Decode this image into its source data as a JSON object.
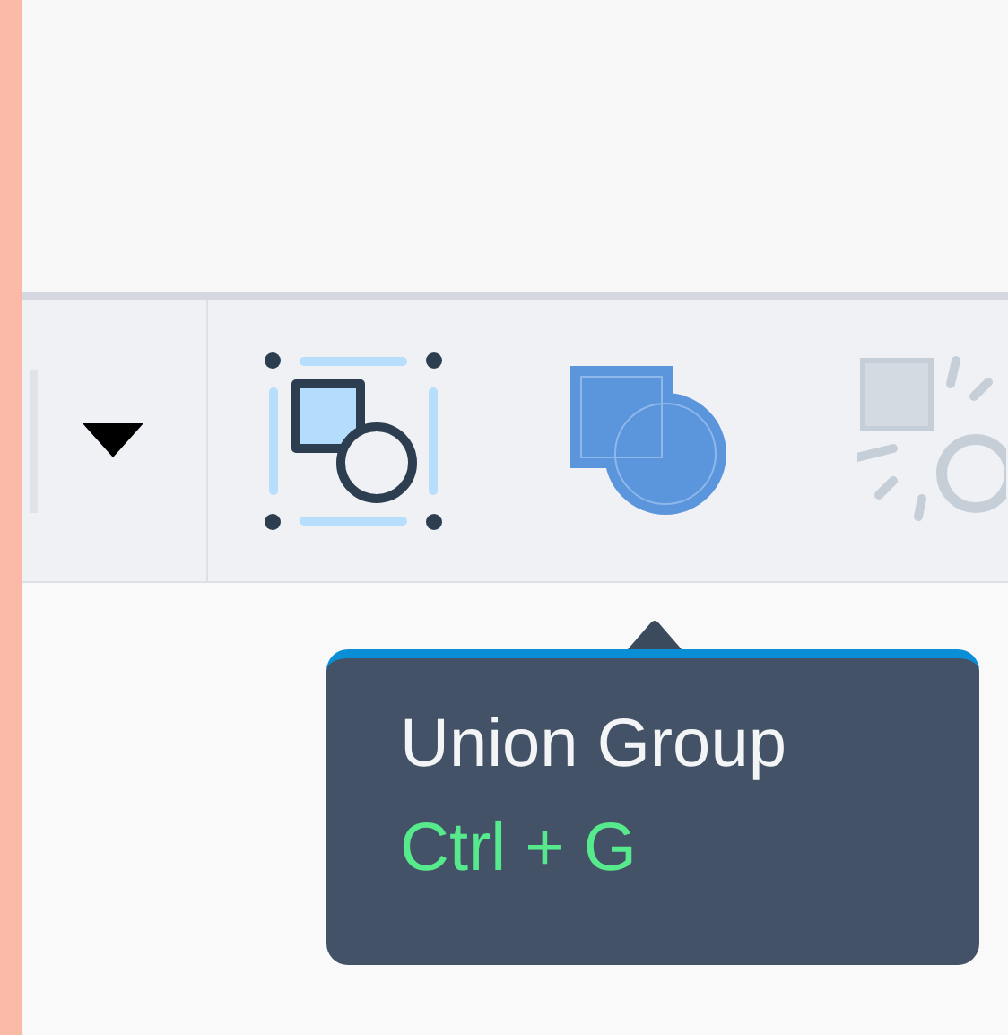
{
  "toolbar": {
    "tools": [
      {
        "kind": "group",
        "disabled": false
      },
      {
        "kind": "union",
        "disabled": false
      },
      {
        "kind": "ungroup",
        "disabled": true
      }
    ]
  },
  "tooltip": {
    "title": "Union Group",
    "shortcut": "Ctrl + G"
  }
}
